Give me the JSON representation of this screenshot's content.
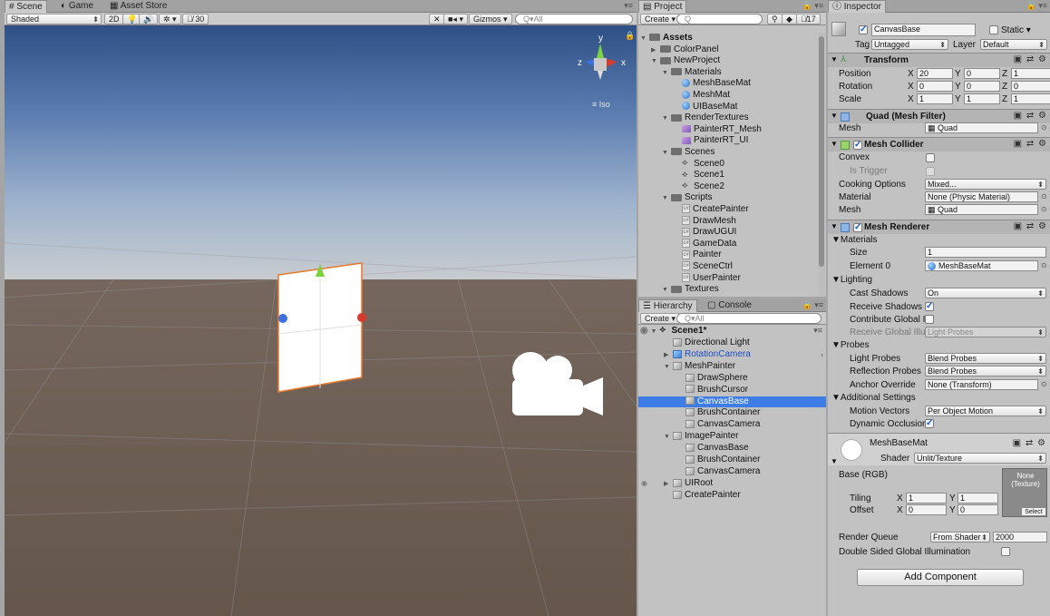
{
  "scene_window": {
    "tabs": [
      "Scene",
      "Game",
      "Asset Store"
    ],
    "shading": "Shaded",
    "toolbar": {
      "mode_2d": "2D",
      "hidden_count": "30",
      "gizmos": "Gizmos",
      "search_placeholder": "Q▾All"
    },
    "persp_label": "Iso",
    "gizmo_axes": {
      "y": "y",
      "z": "z",
      "x": "x"
    }
  },
  "project": {
    "tab": "Project",
    "create": "Create",
    "search_placeholder": "Q",
    "hidden_count": "17",
    "tree": [
      {
        "label": "Assets",
        "icon": "folder",
        "depth": 0,
        "open": true,
        "bold": true
      },
      {
        "label": "ColorPanel",
        "icon": "folder",
        "depth": 1,
        "open": false
      },
      {
        "label": "NewProject",
        "icon": "folder",
        "depth": 1,
        "open": true
      },
      {
        "label": "Materials",
        "icon": "folder",
        "depth": 2,
        "open": true
      },
      {
        "label": "MeshBaseMat",
        "icon": "sphere",
        "depth": 3
      },
      {
        "label": "MeshMat",
        "icon": "sphere",
        "depth": 3
      },
      {
        "label": "UIBaseMat",
        "icon": "sphere",
        "depth": 3
      },
      {
        "label": "RenderTextures",
        "icon": "folder",
        "depth": 2,
        "open": true
      },
      {
        "label": "PainterRT_Mesh",
        "icon": "rtex",
        "depth": 3
      },
      {
        "label": "PainterRT_UI",
        "icon": "rtex",
        "depth": 3
      },
      {
        "label": "Scenes",
        "icon": "folder",
        "depth": 2,
        "open": true
      },
      {
        "label": "Scene0",
        "icon": "unity",
        "depth": 3
      },
      {
        "label": "Scene1",
        "icon": "unity",
        "depth": 3
      },
      {
        "label": "Scene2",
        "icon": "unity",
        "depth": 3
      },
      {
        "label": "Scripts",
        "icon": "folder",
        "depth": 2,
        "open": true
      },
      {
        "label": "CreatePainter",
        "icon": "cs",
        "depth": 3
      },
      {
        "label": "DrawMesh",
        "icon": "cs",
        "depth": 3
      },
      {
        "label": "DrawUGUI",
        "icon": "cs",
        "depth": 3
      },
      {
        "label": "GameData",
        "icon": "cs",
        "depth": 3
      },
      {
        "label": "Painter",
        "icon": "cs",
        "depth": 3
      },
      {
        "label": "SceneCtrl",
        "icon": "cs",
        "depth": 3
      },
      {
        "label": "UserPainter",
        "icon": "cs",
        "depth": 3
      },
      {
        "label": "Textures",
        "icon": "folder",
        "depth": 2,
        "open": true
      }
    ]
  },
  "hierarchy": {
    "tabs": [
      "Hierarchy",
      "Console"
    ],
    "create": "Create",
    "search_placeholder": "Q▾All",
    "scene": "Scene1*",
    "items": [
      {
        "label": "Directional Light",
        "depth": 1,
        "arrow": "",
        "prefab": false,
        "selected": false
      },
      {
        "label": "RotationCamera",
        "depth": 1,
        "arrow": "▶",
        "prefab": true,
        "selected": false
      },
      {
        "label": "MeshPainter",
        "depth": 1,
        "arrow": "▼",
        "prefab": false,
        "selected": false
      },
      {
        "label": "DrawSphere",
        "depth": 2,
        "arrow": "",
        "prefab": false,
        "selected": false
      },
      {
        "label": "BrushCursor",
        "depth": 2,
        "arrow": "",
        "prefab": false,
        "selected": false
      },
      {
        "label": "CanvasBase",
        "depth": 2,
        "arrow": "",
        "prefab": false,
        "selected": true
      },
      {
        "label": "BrushContainer",
        "depth": 2,
        "arrow": "",
        "prefab": false,
        "selected": false
      },
      {
        "label": "CanvasCamera",
        "depth": 2,
        "arrow": "",
        "prefab": false,
        "selected": false
      },
      {
        "label": "ImagePainter",
        "depth": 1,
        "arrow": "▼",
        "prefab": false,
        "selected": false
      },
      {
        "label": "CanvasBase",
        "depth": 2,
        "arrow": "",
        "prefab": false,
        "selected": false
      },
      {
        "label": "BrushContainer",
        "depth": 2,
        "arrow": "",
        "prefab": false,
        "selected": false
      },
      {
        "label": "CanvasCamera",
        "depth": 2,
        "arrow": "",
        "prefab": false,
        "selected": false
      },
      {
        "label": "UIRoot",
        "depth": 1,
        "arrow": "▶",
        "prefab": false,
        "selected": false
      },
      {
        "label": "CreatePainter",
        "depth": 1,
        "arrow": "",
        "prefab": false,
        "selected": false
      }
    ]
  },
  "inspector": {
    "tab": "Inspector",
    "object_name": "CanvasBase",
    "static_label": "Static",
    "tag_label": "Tag",
    "tag_value": "Untagged",
    "layer_label": "Layer",
    "layer_value": "Default",
    "transform": {
      "title": "Transform",
      "position_label": "Position",
      "rotation_label": "Rotation",
      "scale_label": "Scale",
      "axis_x": "X",
      "axis_y": "Y",
      "axis_z": "Z",
      "position": [
        "20",
        "0",
        "1"
      ],
      "rotation": [
        "0",
        "0",
        "0"
      ],
      "scale": [
        "1",
        "1",
        "1"
      ]
    },
    "mesh_filter": {
      "title": "Quad (Mesh Filter)",
      "mesh_label": "Mesh",
      "mesh_value": "Quad"
    },
    "mesh_collider": {
      "title": "Mesh Collider",
      "convex": "Convex",
      "is_trigger": "Is Trigger",
      "cooking_label": "Cooking Options",
      "cooking_value": "Mixed...",
      "material_label": "Material",
      "material_value": "None (Physic Material)",
      "mesh_label": "Mesh",
      "mesh_value": "Quad"
    },
    "mesh_renderer": {
      "title": "Mesh Renderer",
      "materials": "Materials",
      "size_label": "Size",
      "size_value": "1",
      "element_label": "Element 0",
      "element_value": "MeshBaseMat",
      "lighting": "Lighting",
      "cast_label": "Cast Shadows",
      "cast_value": "On",
      "receive_label": "Receive Shadows",
      "contribute_label": "Contribute Global Ill",
      "receive_gi_label": "Receive Global Illum",
      "receive_gi_value": "Light Probes",
      "probes": "Probes",
      "light_probes_label": "Light Probes",
      "light_probes_value": "Blend Probes",
      "reflection_label": "Reflection Probes",
      "reflection_value": "Blend Probes",
      "anchor_label": "Anchor Override",
      "anchor_value": "None (Transform)",
      "additional": "Additional Settings",
      "motion_label": "Motion Vectors",
      "motion_value": "Per Object Motion",
      "dynamic_label": "Dynamic Occlusion"
    },
    "material": {
      "name": "MeshBaseMat",
      "shader_label": "Shader",
      "shader_value": "Unlit/Texture",
      "base_label": "Base (RGB)",
      "tex_none": "None",
      "tex_type": "(Texture)",
      "select": "Select",
      "tiling_label": "Tiling",
      "offset_label": "Offset",
      "axis_x": "X",
      "axis_y": "Y",
      "tiling": [
        "1",
        "1"
      ],
      "offset": [
        "0",
        "0"
      ],
      "render_queue_label": "Render Queue",
      "render_queue_mode": "From Shader",
      "render_queue_value": "2000",
      "double_sided": "Double Sided Global Illumination"
    },
    "add_component": "Add Component"
  }
}
